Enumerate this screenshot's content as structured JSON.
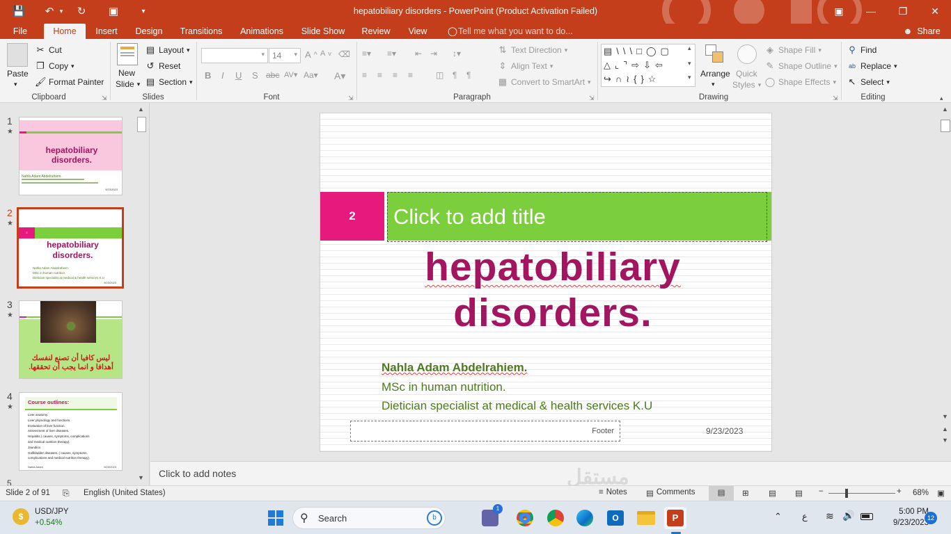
{
  "window": {
    "title": "hepatobiliary disorders - PowerPoint (Product Activation Failed)",
    "share_label": "Share",
    "tell_me": "Tell me what you want to do..."
  },
  "tabs": [
    "File",
    "Home",
    "Insert",
    "Design",
    "Transitions",
    "Animations",
    "Slide Show",
    "Review",
    "View"
  ],
  "ribbon": {
    "clipboard": {
      "label": "Clipboard",
      "paste": "Paste",
      "cut": "Cut",
      "copy": "Copy",
      "format_painter": "Format Painter"
    },
    "slides": {
      "label": "Slides",
      "new_slide_1": "New",
      "new_slide_2": "Slide",
      "layout": "Layout",
      "reset": "Reset",
      "section": "Section"
    },
    "font": {
      "label": "Font",
      "size": "14"
    },
    "paragraph": {
      "label": "Paragraph",
      "text_direction": "Text Direction",
      "align_text": "Align Text",
      "convert_smartart": "Convert to SmartArt"
    },
    "drawing": {
      "label": "Drawing",
      "arrange": "Arrange",
      "quick_styles_1": "Quick",
      "quick_styles_2": "Styles",
      "shape_fill": "Shape Fill",
      "shape_outline": "Shape Outline",
      "shape_effects": "Shape Effects"
    },
    "editing": {
      "label": "Editing",
      "find": "Find",
      "replace": "Replace",
      "select": "Select"
    }
  },
  "thumbnails": [
    {
      "num": "1",
      "title": "hepatobiliary disorders.",
      "line": "Nahla Adam Abdelrahiem.",
      "date": "9/23/2023"
    },
    {
      "num": "2",
      "title": "hepatobiliary disorders.",
      "line1": "Nahla Adam Abdelrahiem.",
      "line2": "MSc in human nutrition.",
      "line3": "Dietician specialist at medical & health services K.U",
      "date": "9/23/2023",
      "badge": "2"
    },
    {
      "num": "3",
      "arabic1": "ليس كافيا أن تصنع لنفسك",
      "arabic2": "أهدافا و انما يجب أن تحققها."
    },
    {
      "num": "4",
      "title": "Course outlines:",
      "items": [
        "Liver anatomy.",
        "Liver physiology and functions.",
        "Evaluation of liver function.",
        "Assessment of liver diseases.",
        "Hepatitis.( causes, symptoms, complications",
        "and medical nutrition therapy).",
        "Jaundice.",
        "Gallbladder diseases. ( causes, symptoms,",
        "complications and medical nutrition therapy)."
      ],
      "footer": "Nahla Adam",
      "date": "9/23/2023"
    }
  ],
  "slide": {
    "number_badge": "2",
    "title_placeholder": "Click to add title",
    "main_title_1": "hepatobiliary",
    "main_title_2": "disorders.",
    "author": "Nahla Adam Abdelrahiem.",
    "degree": "MSc in human nutrition.",
    "role": "Dietician specialist at medical & health services K.U",
    "footer": "Footer",
    "date": "9/23/2023"
  },
  "notes_placeholder": "Click to add notes",
  "status": {
    "slide_of": "Slide 2 of 91",
    "language": "English (United States)",
    "notes": "Notes",
    "comments": "Comments",
    "zoom": "68%"
  },
  "taskbar": {
    "ticker": "USD/JPY",
    "change": "+0.54%",
    "search": "Search",
    "time": "5:00 PM",
    "date": "9/23/2023",
    "notif_count": "12",
    "lang_indicator": "ع",
    "teams_badge": "1"
  },
  "colors": {
    "accent": "#c43e1c",
    "green": "#7ccf3c",
    "magenta": "#e6197d",
    "title": "#a3155f",
    "text_green": "#4d7a1c"
  }
}
